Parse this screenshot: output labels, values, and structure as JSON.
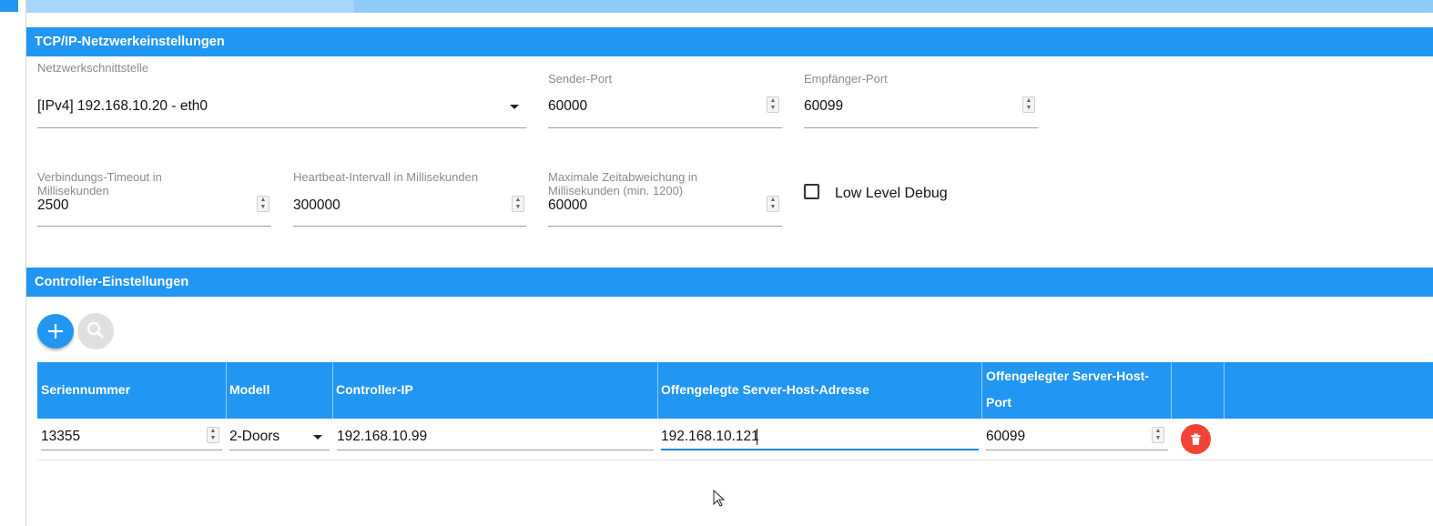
{
  "sections": {
    "network": "TCP/IP-Netzwerkeinstellungen",
    "controller": "Controller-Einstellungen"
  },
  "network": {
    "interface": {
      "label": "Netzwerkschnittstelle",
      "value": "[IPv4] 192.168.10.20 - eth0"
    },
    "sender_port": {
      "label": "Sender-Port",
      "value": "60000"
    },
    "receiver_port": {
      "label": "Empfänger-Port",
      "value": "60099"
    },
    "timeout": {
      "label_line1": "Verbindungs-Timeout in",
      "label_line2": "Millisekunden",
      "value": "2500"
    },
    "heartbeat": {
      "label": "Heartbeat-Intervall in Millisekunden",
      "value": "300000"
    },
    "max_deviation": {
      "label_line1": "Maximale Zeitabweichung in",
      "label_line2": "Millisekunden (min. 1200)",
      "value": "60000"
    },
    "low_level_debug": {
      "label": "Low Level Debug",
      "checked": false
    }
  },
  "controller_table": {
    "headers": {
      "serial": "Seriennummer",
      "model": "Modell",
      "ip": "Controller-IP",
      "host_address": "Offengelegte Server-Host-Adresse",
      "host_port_line1": "Offengelegter Server-Host-",
      "host_port_line2": "Port"
    },
    "rows": [
      {
        "serial": "13355",
        "model": "2-Doors",
        "ip": "192.168.10.99",
        "host_address": "192.168.10.121",
        "host_port": "60099"
      }
    ]
  },
  "icons": {
    "add": "plus-icon",
    "search": "search-icon",
    "delete": "trash-icon",
    "dropdown": "caret-down-icon",
    "spinner": "spinner-arrows-icon"
  },
  "colors": {
    "primary": "#2196f3",
    "strip": "#90caf9",
    "danger": "#f44336",
    "disabled": "#e0e0e0"
  }
}
